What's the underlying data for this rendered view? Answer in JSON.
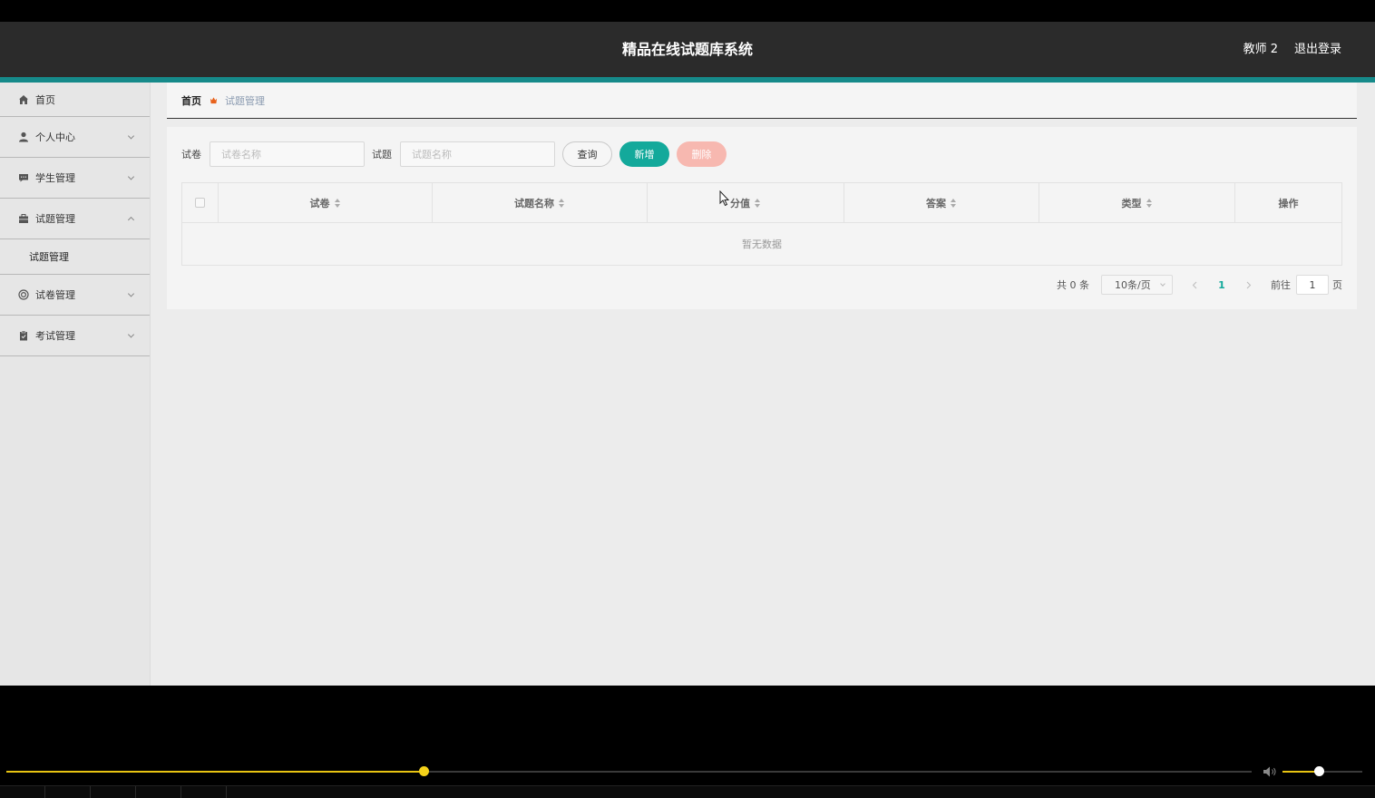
{
  "header": {
    "title": "精品在线试题库系统",
    "user": "教师 2",
    "logout": "退出登录"
  },
  "sidebar": {
    "items": [
      {
        "label": "首页",
        "icon": "home-icon"
      },
      {
        "label": "个人中心",
        "icon": "user-icon"
      },
      {
        "label": "学生管理",
        "icon": "chat-icon"
      },
      {
        "label": "试题管理",
        "icon": "briefcase-icon",
        "expanded": true,
        "children": [
          "试题管理"
        ]
      },
      {
        "label": "试卷管理",
        "icon": "circle-icon"
      },
      {
        "label": "考试管理",
        "icon": "clipboard-icon"
      }
    ]
  },
  "breadcrumb": {
    "home": "首页",
    "current": "试题管理"
  },
  "search": {
    "paper_label": "试卷",
    "paper_placeholder": "试卷名称",
    "question_label": "试题",
    "question_placeholder": "试题名称",
    "query": "查询",
    "add": "新增",
    "delete": "删除"
  },
  "table": {
    "columns": [
      "试卷",
      "试题名称",
      "分值",
      "答案",
      "类型",
      "操作"
    ],
    "empty_text": "暂无数据"
  },
  "pagination": {
    "total": "共 0 条",
    "page_size": "10条/页",
    "current_page": "1",
    "goto": "前往",
    "goto_value": "1",
    "page_suffix": "页"
  },
  "player": {
    "progress": 0.335,
    "volume": 0.45
  },
  "colors": {
    "accent": "#13a99b",
    "header_bg": "#2b2b2b",
    "teal_bar": "#168a8a",
    "danger_light": "#f7b8b0",
    "progress": "#e8c412"
  }
}
